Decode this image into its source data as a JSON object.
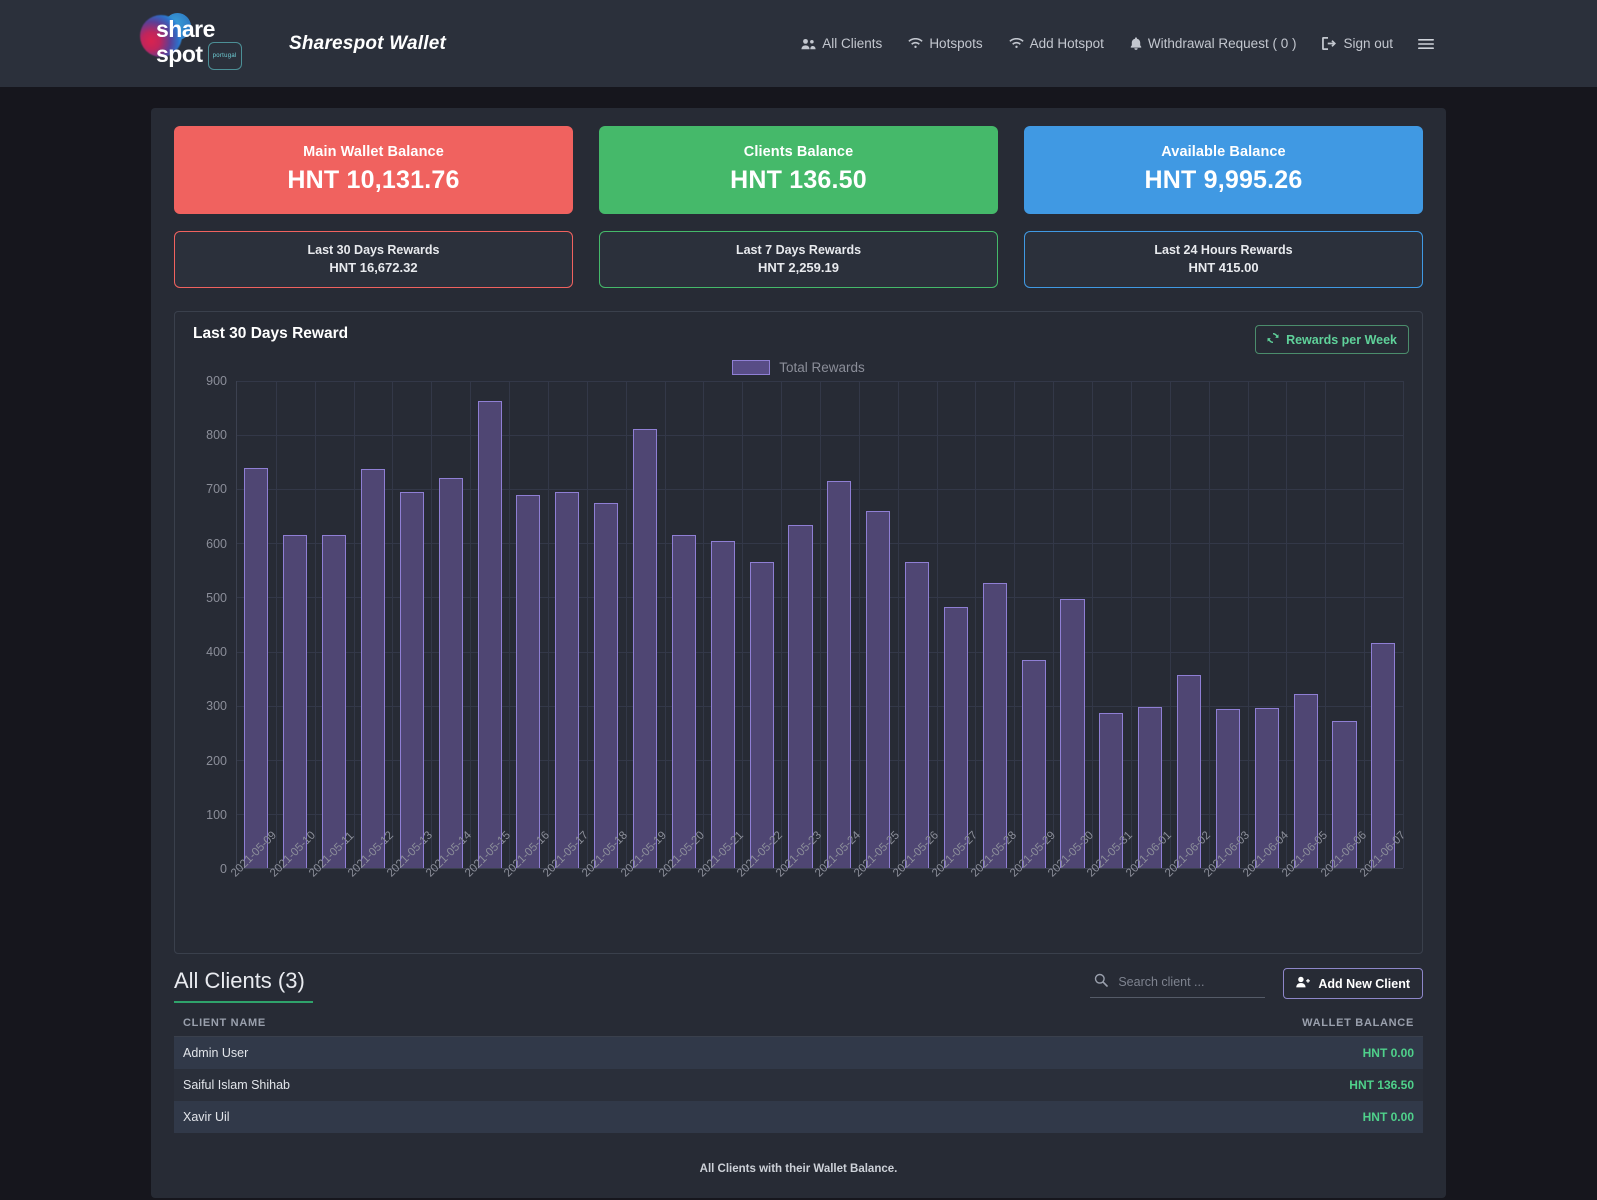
{
  "navbar": {
    "brand_line1": "share",
    "brand_line2": "spot",
    "brand_badge": "portugal",
    "app_title": "Sharespot Wallet",
    "links": [
      {
        "label": "All Clients",
        "icon": "users-icon"
      },
      {
        "label": "Hotspots",
        "icon": "wifi-icon"
      },
      {
        "label": "Add Hotspot",
        "icon": "wifi-icon"
      },
      {
        "label": "Withdrawal Request ( 0 )",
        "icon": "bell-icon"
      },
      {
        "label": "Sign out",
        "icon": "sign-out-icon"
      }
    ],
    "toggler_icon": "navbar-toggler-icon"
  },
  "cards": [
    {
      "label": "Main Wallet Balance",
      "value": "HNT 10,131.76",
      "color": "#f0625f",
      "sub_label": "Last 30 Days Rewards",
      "sub_value": "HNT 16,672.32"
    },
    {
      "label": "Clients Balance",
      "value": "HNT 136.50",
      "color": "#45b96a",
      "sub_label": "Last 7 Days Rewards",
      "sub_value": "HNT 2,259.19"
    },
    {
      "label": "Available Balance",
      "value": "HNT 9,995.26",
      "color": "#4099e3",
      "sub_label": "Last 24 Hours Rewards",
      "sub_value": "HNT 415.00"
    }
  ],
  "chart_panel": {
    "title": "Last 30 Days Reward",
    "button_label": "Rewards per Week",
    "button_icon": "refresh-icon"
  },
  "chart_data": {
    "type": "bar",
    "title": "Last 30 Days Reward",
    "xlabel": "",
    "ylabel": "",
    "ylim": [
      0,
      900
    ],
    "yticks": [
      0,
      100,
      200,
      300,
      400,
      500,
      600,
      700,
      800,
      900
    ],
    "grid": true,
    "legend": {
      "position": "top-center",
      "entries": [
        "Total Rewards"
      ]
    },
    "series_color": "#4f4673",
    "series_border_color": "#8f7fd4",
    "categories": [
      "2021-05-09",
      "2021-05-10",
      "2021-05-11",
      "2021-05-12",
      "2021-05-13",
      "2021-05-14",
      "2021-05-15",
      "2021-05-16",
      "2021-05-17",
      "2021-05-18",
      "2021-05-19",
      "2021-05-20",
      "2021-05-21",
      "2021-05-22",
      "2021-05-23",
      "2021-05-24",
      "2021-05-25",
      "2021-05-26",
      "2021-05-27",
      "2021-05-28",
      "2021-05-29",
      "2021-05-30",
      "2021-05-31",
      "2021-06-01",
      "2021-06-02",
      "2021-06-03",
      "2021-06-04",
      "2021-06-05",
      "2021-06-06",
      "2021-06-07"
    ],
    "series": [
      {
        "name": "Total Rewards",
        "values": [
          740,
          616,
          615,
          738,
          695,
          721,
          863,
          690,
          694,
          674,
          812,
          616,
          604,
          565,
          633,
          716,
          660,
          566,
          482,
          526,
          385,
          497,
          287,
          298,
          357,
          294,
          296,
          322,
          272,
          415
        ]
      }
    ]
  },
  "clients": {
    "title": "All Clients (3)",
    "search_placeholder": "Search client ...",
    "search_value": "",
    "search_icon": "search-icon",
    "add_button_label": "Add New Client",
    "add_button_icon": "user-plus-icon",
    "columns": [
      "CLIENT NAME",
      "WALLET BALANCE"
    ],
    "rows": [
      {
        "name": "Admin User",
        "balance": "HNT 0.00"
      },
      {
        "name": "Saiful Islam Shihab",
        "balance": "HNT 136.50"
      },
      {
        "name": "Xavir Uil",
        "balance": "HNT 0.00"
      }
    ],
    "note": "All Clients with their Wallet Balance."
  }
}
